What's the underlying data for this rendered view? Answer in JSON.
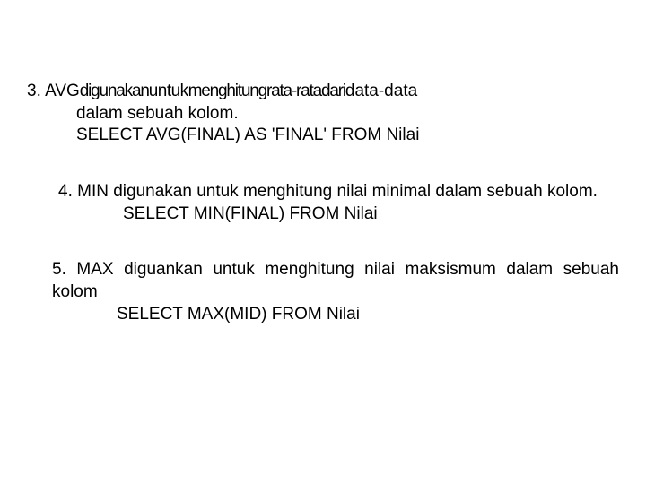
{
  "item3": {
    "line1_a": "3. AVG",
    "line1_b": "digunakan",
    "line1_c": "untuk",
    "line1_d": "menghitung",
    "line1_e": "rata-rata",
    "line1_f": "dari",
    "line1_g": "data-data",
    "line2": "dalam sebuah kolom.",
    "line3": "SELECT  AVG(FINAL)  AS  'FINAL'  FROM  Nilai"
  },
  "item4": {
    "text": "4.  MIN  digunakan  untuk  menghitung  nilai  minimal  dalam sebuah kolom.",
    "sql": "SELECT MIN(FINAL) FROM Nilai"
  },
  "item5": {
    "text": "5. MAX diguankan untuk menghitung nilai maksismum dalam sebuah kolom",
    "sql": "SELECT MAX(MID) FROM Nilai"
  }
}
